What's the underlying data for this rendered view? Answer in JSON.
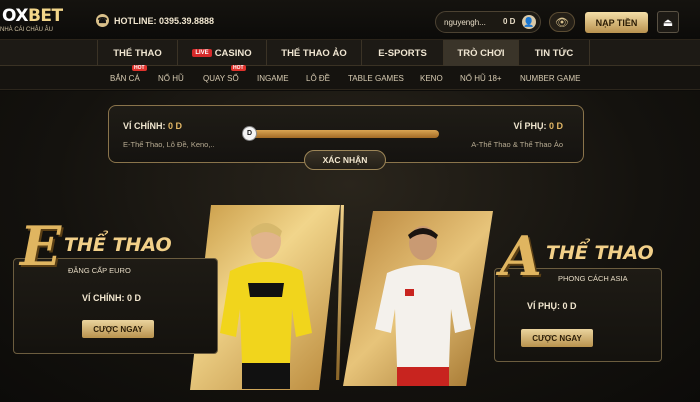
{
  "header": {
    "logo_main_left": "OX",
    "logo_main_right": "BET",
    "logo_sub": "NHÀ CÁI CHÂU ÂU",
    "hotline": "HOTLINE: 0395.39.8888",
    "username": "nguyengh...",
    "balance": "0 D",
    "deposit_label": "NẠP TIỀN"
  },
  "nav_main": [
    {
      "label": "THỂ THAO",
      "badge": ""
    },
    {
      "label": "CASINO",
      "badge": "LIVE"
    },
    {
      "label": "THỂ THAO ẢO",
      "badge": ""
    },
    {
      "label": "E-SPORTS",
      "badge": ""
    },
    {
      "label": "TRÒ CHƠI",
      "badge": ""
    },
    {
      "label": "TIN TỨC",
      "badge": ""
    }
  ],
  "nav_sub": [
    {
      "label": "BẮN CÁ",
      "hot": "HOT"
    },
    {
      "label": "NỔ HŨ",
      "hot": ""
    },
    {
      "label": "QUAY SỐ",
      "hot": "HOT"
    },
    {
      "label": "INGAME",
      "hot": ""
    },
    {
      "label": "LÔ ĐỀ",
      "hot": ""
    },
    {
      "label": "TABLE GAMES",
      "hot": ""
    },
    {
      "label": "KENO",
      "hot": ""
    },
    {
      "label": "NỔ HŨ 18+",
      "hot": ""
    },
    {
      "label": "NUMBER GAME",
      "hot": ""
    }
  ],
  "transfer": {
    "main_wallet_label": "VÍ CHÍNH:",
    "main_wallet_value": "0 D",
    "main_wallet_desc": "E-Thể Thao, Lô Đề, Keno,..",
    "sub_wallet_label": "VÍ PHỤ:",
    "sub_wallet_value": "0 D",
    "sub_wallet_desc": "A-Thể Thao & Thể Thao Ảo",
    "slider_handle": "D",
    "confirm_label": "XÁC NHẬN"
  },
  "card_e": {
    "letter": "E",
    "title": "THỂ THAO",
    "subtitle": "ĐẲNG CẤP EURO",
    "balance": "VÍ CHÍNH: 0 D",
    "button": "CƯỢC NGAY"
  },
  "card_a": {
    "letter": "A",
    "title": "THỂ THAO",
    "subtitle": "PHONG CÁCH ASIA",
    "balance": "VÍ PHỤ: 0 D",
    "button": "CƯỢC NGAY"
  },
  "colors": {
    "accent_gold": "#e0b560",
    "button_gold": "#d9bd7f",
    "live_red": "#d62a2a",
    "bg_dark": "#14120e"
  }
}
